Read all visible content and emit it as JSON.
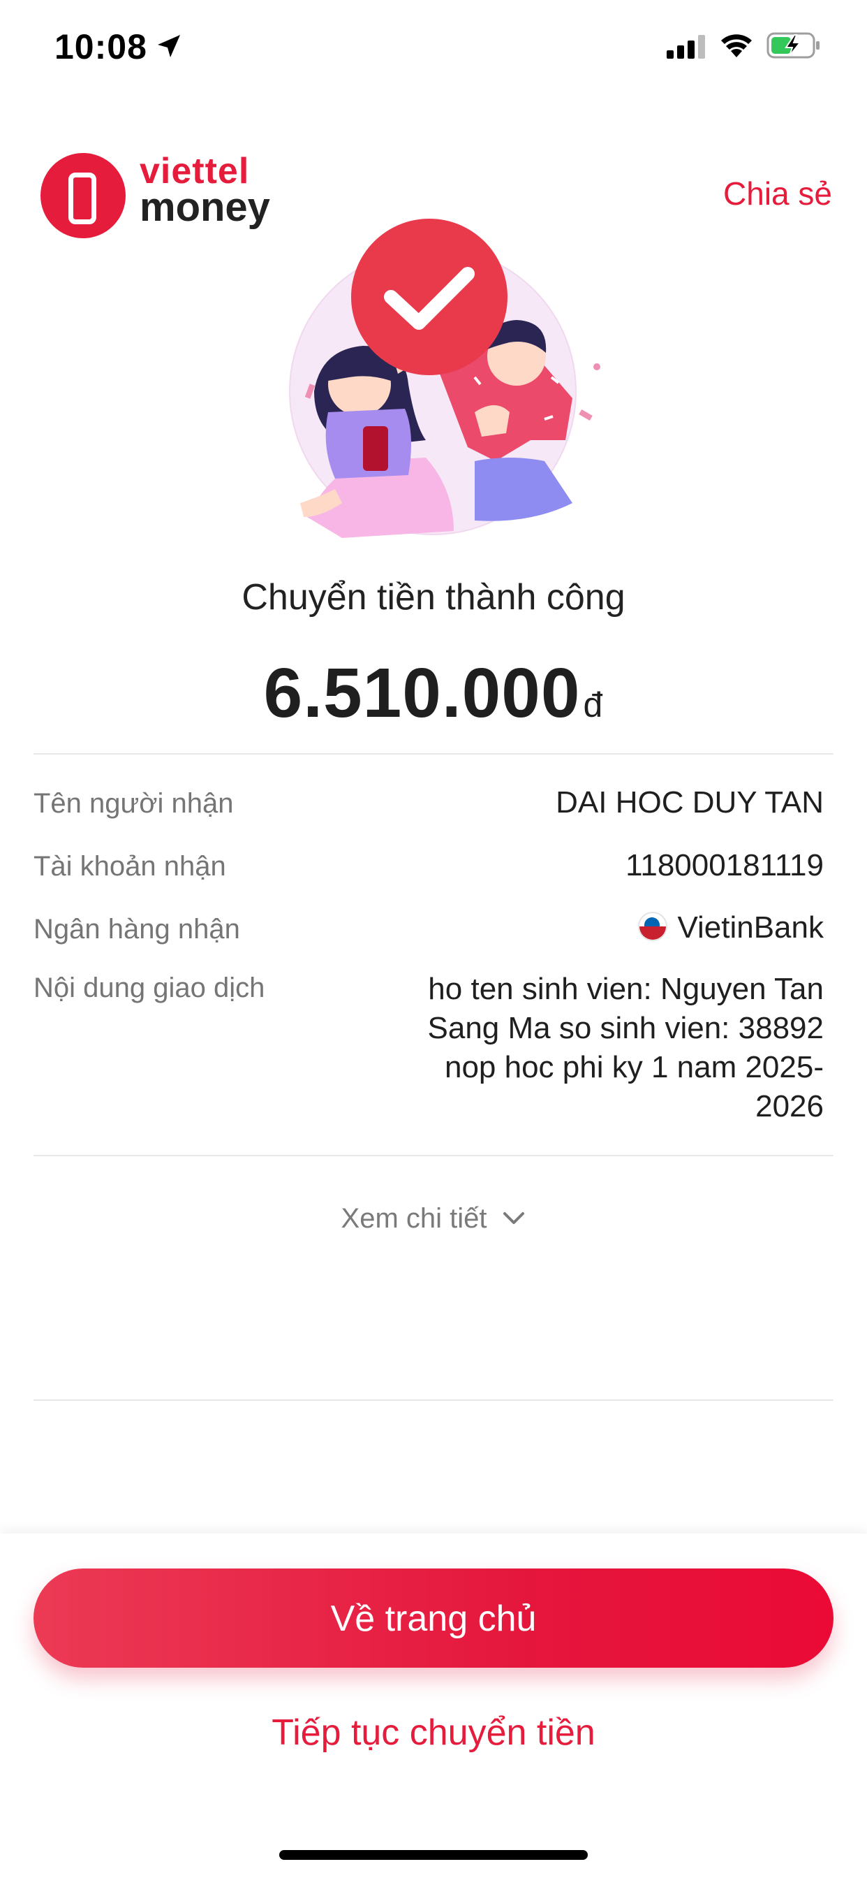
{
  "status_bar": {
    "time": "10:08",
    "battery_color": "#34c759"
  },
  "header": {
    "brand_line1": "viettel",
    "brand_line2": "money",
    "share_label": "Chia sẻ"
  },
  "result": {
    "title": "Chuyển tiền thành công",
    "amount": "6.510.000",
    "currency": "đ"
  },
  "details": {
    "recipient_name_label": "Tên người nhận",
    "recipient_name": "DAI HOC DUY TAN",
    "account_label": "Tài khoản nhận",
    "account": "118000181119",
    "bank_label": "Ngân hàng nhận",
    "bank": "VietinBank",
    "content_label": "Nội dung giao dịch",
    "content": "ho ten sinh vien: Nguyen Tan Sang Ma so sinh vien: 38892 nop hoc phi ky 1 nam 2025-2026"
  },
  "detail_toggle": "Xem chi tiết",
  "actions": {
    "primary": "Về trang chủ",
    "secondary": "Tiếp tục chuyển tiền"
  },
  "colors": {
    "accent": "#e51c3b",
    "text": "#1f1f1f",
    "muted": "#757575"
  }
}
